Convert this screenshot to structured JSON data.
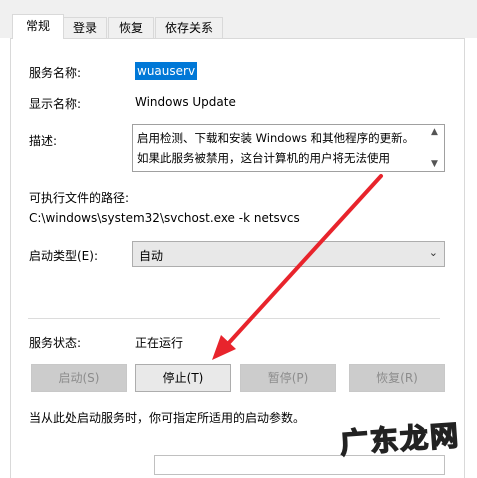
{
  "tabs": [
    "常规",
    "登录",
    "恢复",
    "依存关系"
  ],
  "fields": {
    "service_name_label": "服务名称:",
    "service_name_value": "wuauserv",
    "display_name_label": "显示名称:",
    "display_name_value": "Windows Update",
    "description_label": "描述:",
    "description_value": "启用检测、下载和安装 Windows 和其他程序的更新。如果此服务被禁用，这台计算机的用户将无法使用",
    "exe_path_label": "可执行文件的路径:",
    "exe_path_value": "C:\\windows\\system32\\svchost.exe -k netsvcs",
    "startup_type_label": "启动类型(E):",
    "startup_type_value": "自动",
    "service_status_label": "服务状态:",
    "service_status_value": "正在运行"
  },
  "buttons": {
    "start": "启动(S)",
    "stop": "停止(T)",
    "pause": "暂停(P)",
    "resume": "恢复(R)"
  },
  "hint": "当从此处启动服务时，你可指定所适用的启动参数。",
  "watermark": "广东龙网",
  "colors": {
    "selection": "#0078d7",
    "annotation_arrow": "#e8242c"
  }
}
